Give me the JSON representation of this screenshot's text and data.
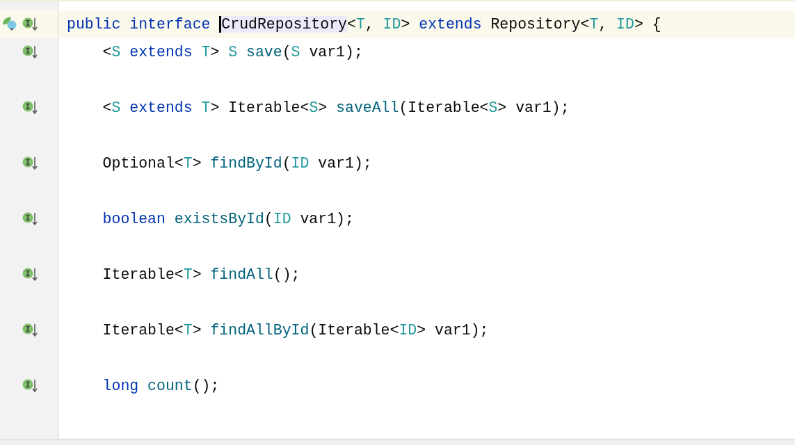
{
  "editor": {
    "lines": [
      {
        "kind": "declaration",
        "current": true,
        "tokens": [
          {
            "kind": "keyword",
            "text": "public interface "
          },
          {
            "kind": "plain",
            "text": "CrudRepository",
            "selected": true,
            "caret": true
          },
          {
            "kind": "plain",
            "text": "<"
          },
          {
            "kind": "typeparam",
            "text": "T"
          },
          {
            "kind": "plain",
            "text": ", "
          },
          {
            "kind": "typeparam",
            "text": "ID"
          },
          {
            "kind": "plain",
            "text": "> "
          },
          {
            "kind": "keyword",
            "text": "extends "
          },
          {
            "kind": "plain",
            "text": "Repository<"
          },
          {
            "kind": "typeparam",
            "text": "T"
          },
          {
            "kind": "plain",
            "text": ", "
          },
          {
            "kind": "typeparam",
            "text": "ID"
          },
          {
            "kind": "plain",
            "text": "> {"
          }
        ]
      },
      {
        "kind": "method",
        "current": false,
        "tokens": [
          {
            "kind": "plain",
            "text": "<"
          },
          {
            "kind": "typeparam",
            "text": "S "
          },
          {
            "kind": "keyword",
            "text": "extends "
          },
          {
            "kind": "typeparam",
            "text": "T"
          },
          {
            "kind": "plain",
            "text": "> "
          },
          {
            "kind": "typeparam",
            "text": "S "
          },
          {
            "kind": "method",
            "text": "save"
          },
          {
            "kind": "plain",
            "text": "("
          },
          {
            "kind": "typeparam",
            "text": "S "
          },
          {
            "kind": "plain",
            "text": "var1);"
          }
        ]
      },
      {
        "kind": "method",
        "current": false,
        "tokens": [
          {
            "kind": "plain",
            "text": "<"
          },
          {
            "kind": "typeparam",
            "text": "S "
          },
          {
            "kind": "keyword",
            "text": "extends "
          },
          {
            "kind": "typeparam",
            "text": "T"
          },
          {
            "kind": "plain",
            "text": "> Iterable<"
          },
          {
            "kind": "typeparam",
            "text": "S"
          },
          {
            "kind": "plain",
            "text": "> "
          },
          {
            "kind": "method",
            "text": "saveAll"
          },
          {
            "kind": "plain",
            "text": "(Iterable<"
          },
          {
            "kind": "typeparam",
            "text": "S"
          },
          {
            "kind": "plain",
            "text": "> var1);"
          }
        ]
      },
      {
        "kind": "method",
        "current": false,
        "tokens": [
          {
            "kind": "plain",
            "text": "Optional<"
          },
          {
            "kind": "typeparam",
            "text": "T"
          },
          {
            "kind": "plain",
            "text": "> "
          },
          {
            "kind": "method",
            "text": "findById"
          },
          {
            "kind": "plain",
            "text": "("
          },
          {
            "kind": "typeparam",
            "text": "ID "
          },
          {
            "kind": "plain",
            "text": "var1);"
          }
        ]
      },
      {
        "kind": "method",
        "current": false,
        "tokens": [
          {
            "kind": "keyword",
            "text": "boolean "
          },
          {
            "kind": "method",
            "text": "existsById"
          },
          {
            "kind": "plain",
            "text": "("
          },
          {
            "kind": "typeparam",
            "text": "ID "
          },
          {
            "kind": "plain",
            "text": "var1);"
          }
        ]
      },
      {
        "kind": "method",
        "current": false,
        "tokens": [
          {
            "kind": "plain",
            "text": "Iterable<"
          },
          {
            "kind": "typeparam",
            "text": "T"
          },
          {
            "kind": "plain",
            "text": "> "
          },
          {
            "kind": "method",
            "text": "findAll"
          },
          {
            "kind": "plain",
            "text": "();"
          }
        ]
      },
      {
        "kind": "method",
        "current": false,
        "tokens": [
          {
            "kind": "plain",
            "text": "Iterable<"
          },
          {
            "kind": "typeparam",
            "text": "T"
          },
          {
            "kind": "plain",
            "text": "> "
          },
          {
            "kind": "method",
            "text": "findAllById"
          },
          {
            "kind": "plain",
            "text": "(Iterable<"
          },
          {
            "kind": "typeparam",
            "text": "ID"
          },
          {
            "kind": "plain",
            "text": "> var1);"
          }
        ]
      },
      {
        "kind": "method",
        "current": false,
        "tokens": [
          {
            "kind": "keyword",
            "text": "long "
          },
          {
            "kind": "method",
            "text": "count"
          },
          {
            "kind": "plain",
            "text": "();"
          }
        ]
      }
    ]
  }
}
